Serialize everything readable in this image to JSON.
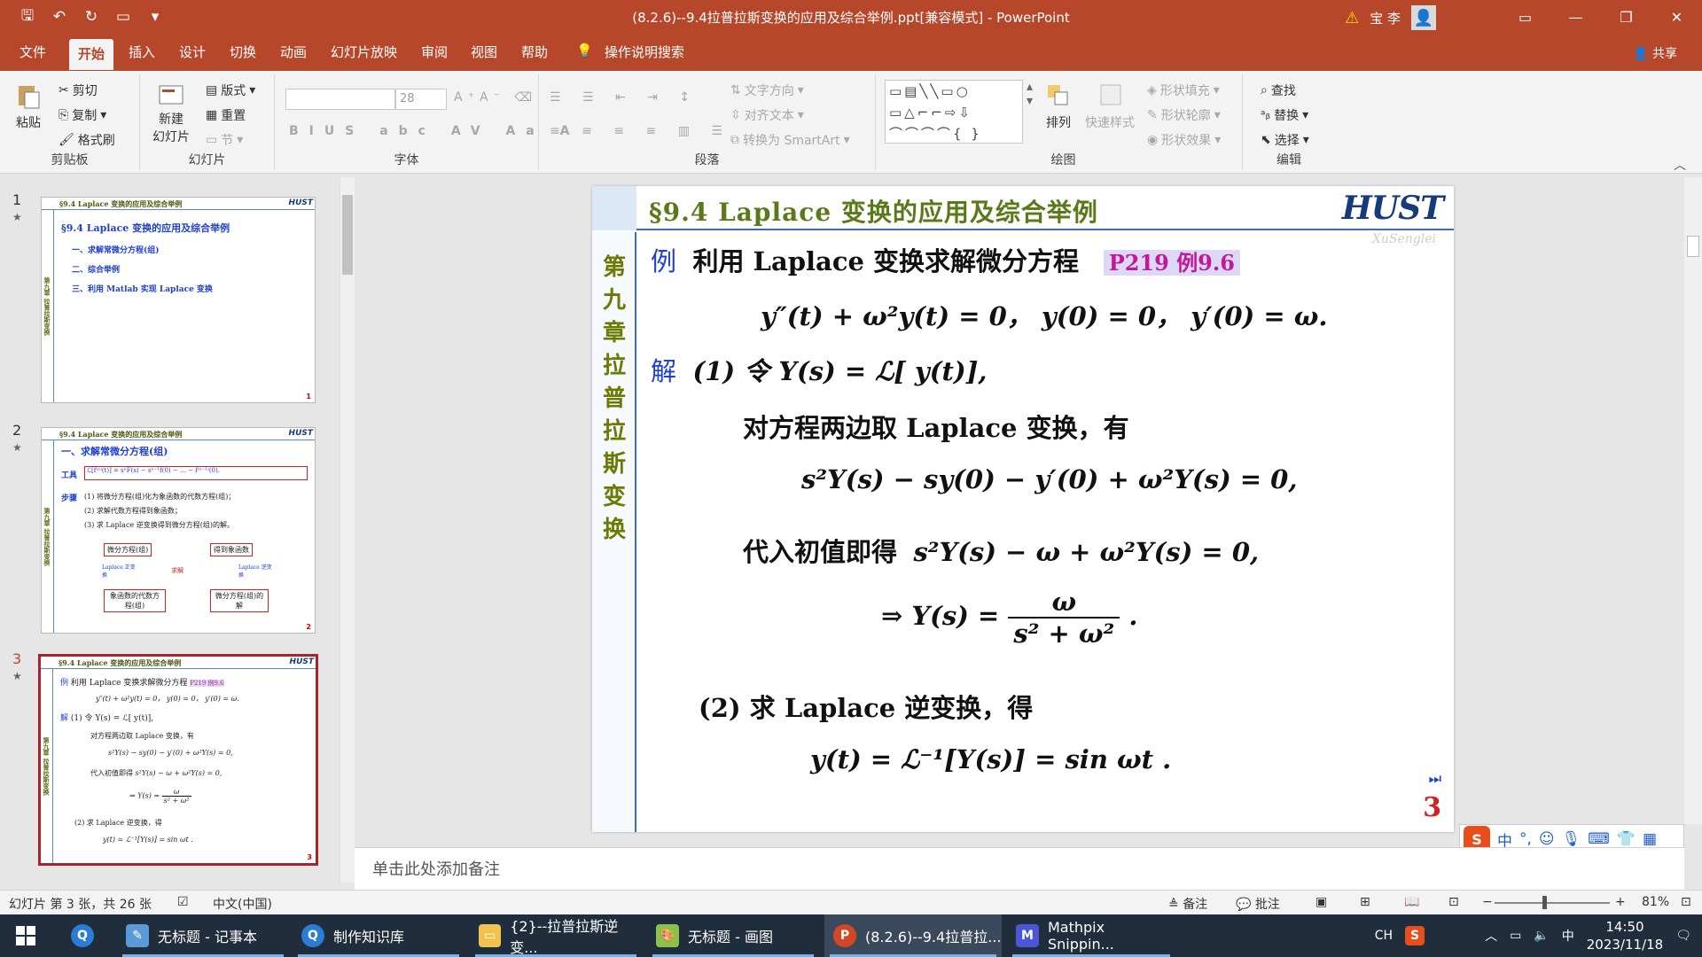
{
  "window": {
    "title": "(8.2.6)--9.4拉普拉斯变换的应用及综合举例.ppt[兼容模式] - PowerPoint",
    "user": "宝 李"
  },
  "menu": {
    "file": "文件",
    "home": "开始",
    "insert": "插入",
    "design": "设计",
    "transitions": "切换",
    "animations": "动画",
    "slideshow": "幻灯片放映",
    "review": "审阅",
    "view": "视图",
    "help": "帮助",
    "tell_me": "操作说明搜索",
    "share": "共享"
  },
  "ribbon": {
    "clipboard": {
      "paste": "粘贴",
      "cut": "剪切",
      "copy": "复制",
      "format_painter": "格式刷",
      "label": "剪贴板"
    },
    "slides": {
      "new_slide_1": "新建",
      "new_slide_2": "幻灯片",
      "layout": "版式",
      "reset": "重置",
      "section": "节",
      "label": "幻灯片"
    },
    "font": {
      "size": "28",
      "label": "字体"
    },
    "paragraph": {
      "text_direction": "文字方向",
      "align_text": "对齐文本",
      "smartart": "转换为 SmartArt",
      "label": "段落"
    },
    "drawing": {
      "arrange": "排列",
      "quick_styles": "快速样式",
      "shape_fill": "形状填充",
      "shape_outline": "形状轮廓",
      "shape_effects": "形状效果",
      "label": "绘图"
    },
    "editing": {
      "find": "查找",
      "replace": "替换",
      "select": "选择",
      "label": "编辑"
    }
  },
  "thumbnails": [
    {
      "num": "1",
      "header": "§9.4 Laplace 变换的应用及综合举例",
      "title": "§9.4 Laplace 变换的应用及综合举例",
      "items": [
        "一、求解常微分方程(组)",
        "二、综合举例",
        "三、利用 Matlab 实现 Laplace 变换"
      ]
    },
    {
      "num": "2",
      "header": "§9.4 Laplace 变换的应用及综合举例",
      "title": "一、求解常微分方程(组)",
      "tool_label": "工具",
      "steps_label": "步骤",
      "steps": [
        "(1) 将微分方程(组)化为象函数的代数方程(组)；",
        "(2) 求解代数方程得到象函数；",
        "(3) 求 Laplace 逆变换得到微分方程(组)的解。"
      ],
      "boxes": [
        "微分方程(组)",
        "得到象函数",
        "象函数的代数方程(组)",
        "微分方程(组)的解"
      ],
      "arrows": [
        "Laplace 正变换",
        "求解",
        "Laplace 逆变换"
      ]
    },
    {
      "num": "3",
      "header": "§9.4 Laplace 变换的应用及综合举例"
    }
  ],
  "slide": {
    "header": "§9.4  Laplace 变换的应用及综合举例",
    "logo": "HUST",
    "logo_sub": "XuSenglei",
    "side": "第九章 拉普拉斯变换",
    "ex_label": "例",
    "ex_text": "利用 Laplace 变换求解微分方程",
    "badge": "P219 例9.6",
    "equation": "y″(t) + ω²y(t) = 0， y(0) = 0， y′(0) = ω.",
    "sol_label": "解",
    "step1": "(1) 令 Y(s) = ℒ[ y(t)],",
    "step1_text": "对方程两边取 Laplace 变换，有",
    "eq2": "s²Y(s) − sy(0) − y′(0) + ω²Y(s) = 0,",
    "step_sub": "代入初值即得",
    "eq3": "s²Y(s) − ω + ω²Y(s) = 0,",
    "eq4_left": "⇒ Y(s) =",
    "eq4_num": "ω",
    "eq4_den": "s² + ω²",
    "eq4_end": ".",
    "step2": "(2) 求 Laplace 逆变换，得",
    "eq5": "y(t) = ℒ⁻¹[Y(s)] = sin ωt .",
    "page": "3"
  },
  "notes_placeholder": "单击此处添加备注",
  "status": {
    "slide_info": "幻灯片 第 3 张，共 26 张",
    "language": "中文(中国)",
    "notes": "备注",
    "comments": "批注",
    "zoom": "81%"
  },
  "taskbar": {
    "items": [
      "无标题 - 记事本",
      "制作知识库",
      "{2}--拉普拉斯逆变...",
      "无标题 - 画图",
      "(8.2.6)--9.4拉普拉...",
      "Mathpix Snippin..."
    ],
    "ime": "CH",
    "time": "14:50",
    "date": "2023/11/18"
  },
  "colors": {
    "accent": "#b7472a",
    "slide_title": "#5a7a1a",
    "highlight": "#c2189c",
    "page_number": "#d42020"
  }
}
